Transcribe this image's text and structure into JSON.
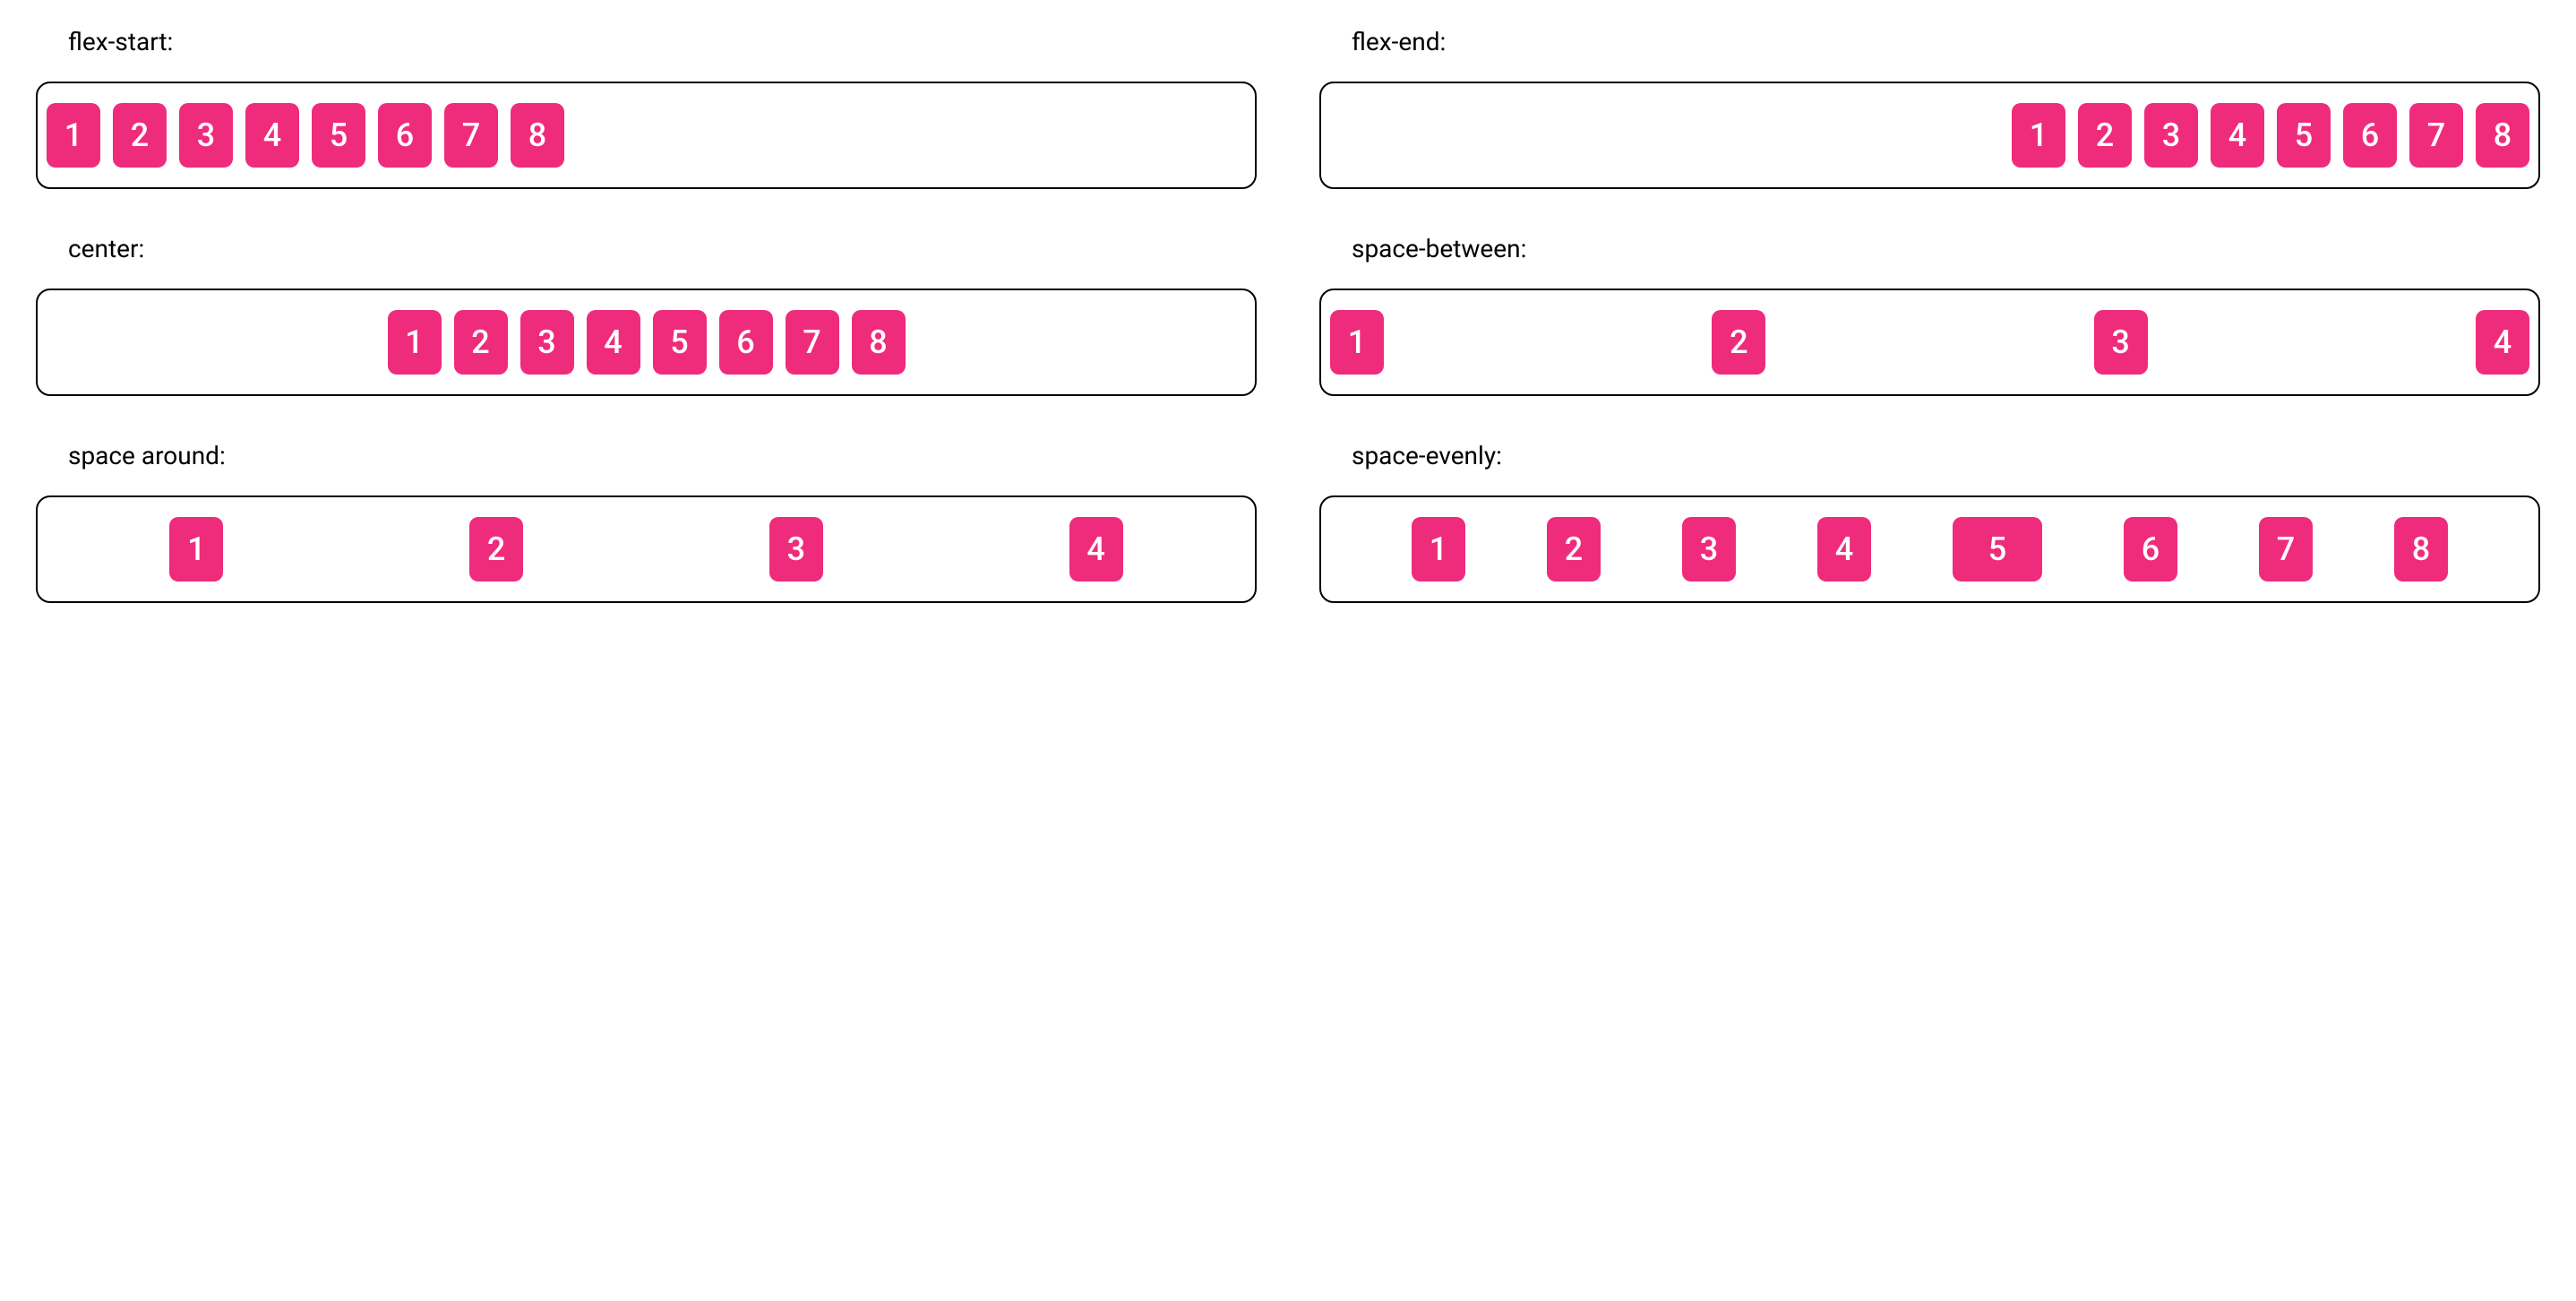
{
  "examples": [
    {
      "name": "flex-start",
      "label": "flex-start:",
      "justify": "flex-start",
      "items": [
        "1",
        "2",
        "3",
        "4",
        "5",
        "6",
        "7",
        "8"
      ],
      "wide_index": -1
    },
    {
      "name": "flex-end",
      "label": "flex-end:",
      "justify": "flex-end",
      "items": [
        "1",
        "2",
        "3",
        "4",
        "5",
        "6",
        "7",
        "8"
      ],
      "wide_index": -1
    },
    {
      "name": "center",
      "label": "center:",
      "justify": "center",
      "items": [
        "1",
        "2",
        "3",
        "4",
        "5",
        "6",
        "7",
        "8"
      ],
      "wide_index": -1
    },
    {
      "name": "space-between",
      "label": "space-between:",
      "justify": "space-between",
      "items": [
        "1",
        "2",
        "3",
        "4"
      ],
      "wide_index": -1
    },
    {
      "name": "space-around",
      "label": "space around:",
      "justify": "space-around",
      "items": [
        "1",
        "2",
        "3",
        "4"
      ],
      "wide_index": -1
    },
    {
      "name": "space-evenly",
      "label": "space-evenly:",
      "justify": "space-evenly",
      "items": [
        "1",
        "2",
        "3",
        "4",
        "5",
        "6",
        "7",
        "8"
      ],
      "wide_index": 4
    }
  ],
  "colors": {
    "item_bg": "#ef2b7c",
    "item_fg": "#ffffff",
    "border": "#000000"
  }
}
